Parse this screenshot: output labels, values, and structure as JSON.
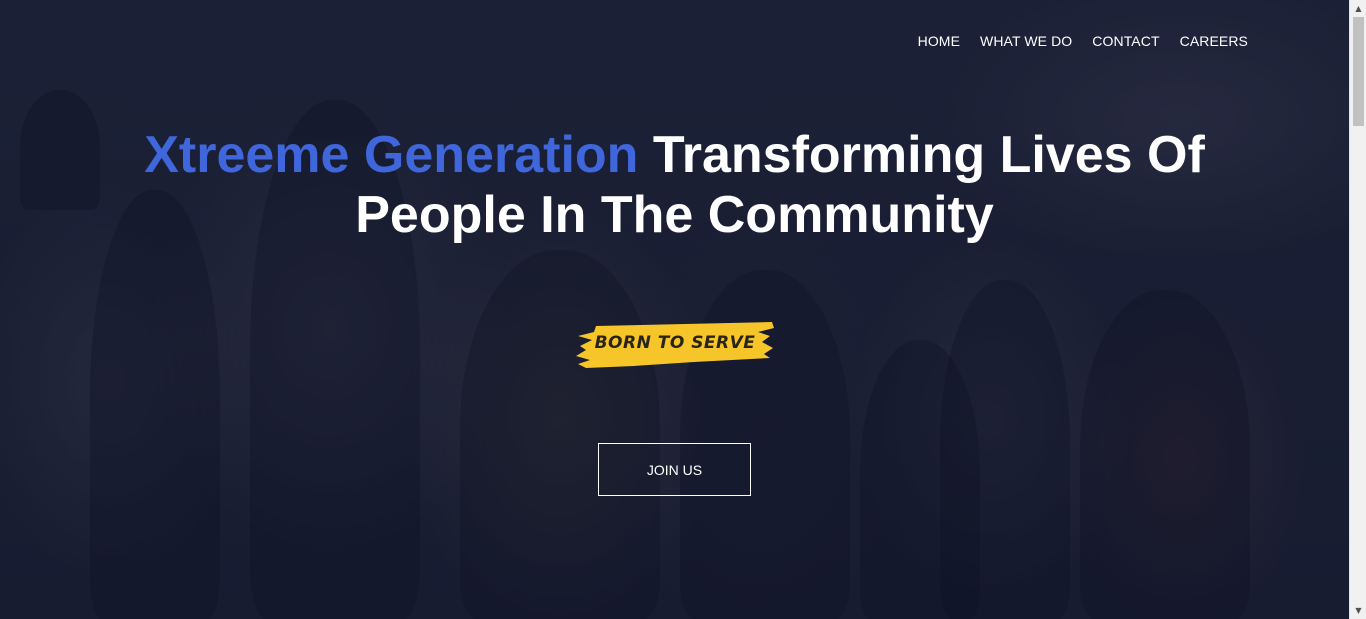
{
  "nav": {
    "items": [
      {
        "label": "HOME"
      },
      {
        "label": "WHAT WE DO"
      },
      {
        "label": "CONTACT"
      },
      {
        "label": "CAREERS"
      }
    ]
  },
  "hero": {
    "headline_accent": "Xtreeme Generation",
    "headline_line1_rest": " Transforming Lives Of",
    "headline_line2": "People In The Community",
    "tagline": "BORN TO SERVE",
    "cta_label": "JOIN US",
    "colors": {
      "accent": "#4066dc",
      "tagline_brush": "#f5c52a",
      "text": "#ffffff",
      "background": "#1f2336"
    }
  },
  "scrollbar": {
    "up_icon": "triangle-up-icon",
    "down_icon": "triangle-down-icon"
  }
}
